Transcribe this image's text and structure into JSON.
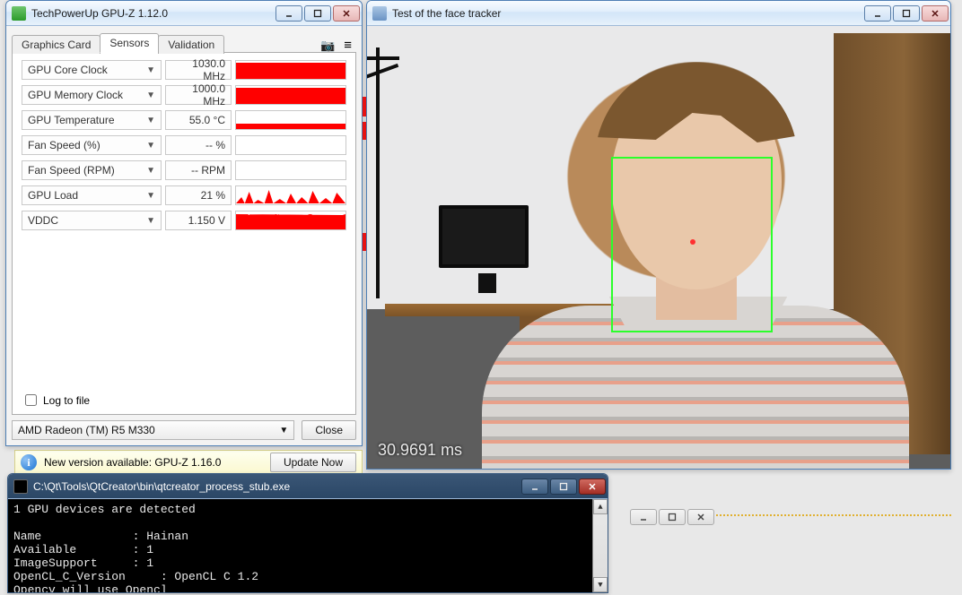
{
  "gpuz": {
    "title": "TechPowerUp GPU-Z 1.12.0",
    "tabs": {
      "graphics_card": "Graphics Card",
      "sensors": "Sensors",
      "validation": "Validation"
    },
    "sensors": [
      {
        "name": "GPU Core Clock",
        "value": "1030.0 MHz",
        "graph": "high"
      },
      {
        "name": "GPU Memory Clock",
        "value": "1000.0 MHz",
        "graph": "high"
      },
      {
        "name": "GPU Temperature",
        "value": "55.0 °C",
        "graph": "low"
      },
      {
        "name": "Fan Speed (%)",
        "value": "-- %",
        "graph": "none"
      },
      {
        "name": "Fan Speed (RPM)",
        "value": "-- RPM",
        "graph": "none"
      },
      {
        "name": "GPU Load",
        "value": "21 %",
        "graph": "spike"
      },
      {
        "name": "VDDC",
        "value": "1.150 V",
        "graph": "spike"
      }
    ],
    "log_to_file": "Log to file",
    "gpu_combo": "AMD Radeon (TM) R5 M330",
    "close_btn": "Close"
  },
  "update_banner": {
    "text": "New version available: GPU-Z 1.16.0",
    "button": "Update Now"
  },
  "facetracker": {
    "title": "Test of the face tracker",
    "overlay": "30.9691 ms"
  },
  "console": {
    "title": "C:\\Qt\\Tools\\QtCreator\\bin\\qtcreator_process_stub.exe",
    "lines": [
      "1 GPU devices are detected",
      "",
      "Name             : Hainan",
      "Available        : 1",
      "ImageSupport     : 1",
      "OpenCL_C_Version     : OpenCL C 1.2",
      "Opencv will use Opencl"
    ]
  }
}
